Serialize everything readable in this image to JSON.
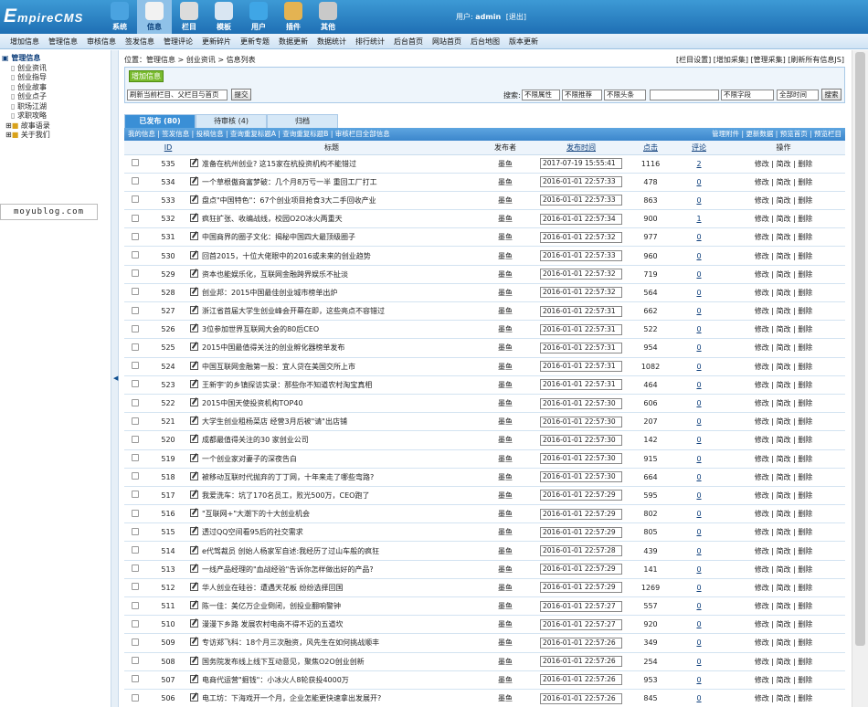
{
  "header": {
    "logo_prefix": "E",
    "logo_rest": "mpireCMS",
    "user_label": "用户:",
    "user_name": "admin",
    "logout": "[退出]",
    "nav": [
      {
        "label": "系统",
        "icon": "globe-icon",
        "color": "#4aa3e0"
      },
      {
        "label": "信息",
        "icon": "document-icon",
        "color": "#f2f2f2"
      },
      {
        "label": "栏目",
        "icon": "folder-icon",
        "color": "#dcdcdc"
      },
      {
        "label": "模板",
        "icon": "template-icon",
        "color": "#d9e6f2"
      },
      {
        "label": "用户",
        "icon": "user-icon",
        "color": "#3fa6e6"
      },
      {
        "label": "插件",
        "icon": "tools-icon",
        "color": "#e4b352"
      },
      {
        "label": "其他",
        "icon": "gear-icon",
        "color": "#c9c9c9"
      }
    ]
  },
  "menu": [
    "增加信息",
    "管理信息",
    "审核信息",
    "签发信息",
    "管理评论",
    "更新碎片",
    "更新专题",
    "数据更新",
    "数据统计",
    "排行统计",
    "后台首页",
    "网站首页",
    "后台地图",
    "版本更新"
  ],
  "tree": {
    "root": "管理信息",
    "items": [
      "创业资讯",
      "创业指导",
      "创业故事",
      "创业点子",
      "职场江湖",
      "求职攻略"
    ],
    "groups": [
      "故事语录",
      "关于我们"
    ]
  },
  "watermark": "moyublog.com",
  "breadcrumb": "位置：管理信息 > 创业资讯 > 信息列表",
  "top_links": "[栏目设置] [增加采集] [管理采集] [刷新所有信息JS]",
  "add_button": "增加信息",
  "refresh_select": "刷新当前栏目、父栏目与首页",
  "refresh_button": "提交",
  "search": {
    "label": "搜索:",
    "f1": "不限属性",
    "f2": "不限推荐",
    "f3": "不限头条",
    "f4": "不限字段",
    "f5": "全部时间",
    "button": "搜索"
  },
  "tabs": [
    "已发布 (80)",
    "待审核 (4)",
    "归档"
  ],
  "subbar_left": "我的信息 | 签发信息 | 投稿信息 | 查询重复标题A | 查询重复标题B | 审核栏目全部信息",
  "subbar_right": "管理附件 | 更新数据 | 预览首页 | 预览栏目",
  "columns": {
    "id": "ID",
    "title": "标题",
    "publisher": "发布者",
    "time": "发布时间",
    "hits": "点击",
    "comments": "评论",
    "ops": "操作"
  },
  "ops_text": "修改 | 简改 | 删除",
  "rows": [
    {
      "id": "535",
      "title": "准备在杭州创业? 这15家在杭投资机构不能错过",
      "pub": "墨鱼",
      "time": "2017-07-19 15:55:41",
      "hits": "1116",
      "cm": "2"
    },
    {
      "id": "534",
      "title": "一个草根傲商富梦破：几个月8万亏一半 重回工厂打工",
      "pub": "墨鱼",
      "time": "2016-01-01 22:57:33",
      "hits": "478",
      "cm": "0"
    },
    {
      "id": "533",
      "title": "盘点\"中国特色\"：67个创业项目抢食3大二手回收产业",
      "pub": "墨鱼",
      "time": "2016-01-01 22:57:33",
      "hits": "863",
      "cm": "0"
    },
    {
      "id": "532",
      "title": "疯狂扩张、收编战线，校园O2O冰火两重天",
      "pub": "墨鱼",
      "time": "2016-01-01 22:57:34",
      "hits": "900",
      "cm": "1"
    },
    {
      "id": "531",
      "title": "中国商界的圈子文化：揭秘中国四大最顶级圈子",
      "pub": "墨鱼",
      "time": "2016-01-01 22:57:32",
      "hits": "977",
      "cm": "0"
    },
    {
      "id": "530",
      "title": "回首2015，十位大佬眼中的2016或未来的创业趋势",
      "pub": "墨鱼",
      "time": "2016-01-01 22:57:33",
      "hits": "960",
      "cm": "0"
    },
    {
      "id": "529",
      "title": "资本也能娱乐化，互联网金融跨界娱乐不扯淡",
      "pub": "墨鱼",
      "time": "2016-01-01 22:57:32",
      "hits": "719",
      "cm": "0"
    },
    {
      "id": "528",
      "title": "创业邦：2015中国最佳创业城市榜单出炉",
      "pub": "墨鱼",
      "time": "2016-01-01 22:57:32",
      "hits": "564",
      "cm": "0"
    },
    {
      "id": "527",
      "title": "浙江省首届大学生创业峰会开幕在即，这些亮点不容错过",
      "pub": "墨鱼",
      "time": "2016-01-01 22:57:31",
      "hits": "662",
      "cm": "0"
    },
    {
      "id": "526",
      "title": "3位参加世界互联网大会的80后CEO",
      "pub": "墨鱼",
      "time": "2016-01-01 22:57:31",
      "hits": "522",
      "cm": "0"
    },
    {
      "id": "525",
      "title": "2015中国最值得关注的创业孵化器榜单发布",
      "pub": "墨鱼",
      "time": "2016-01-01 22:57:31",
      "hits": "954",
      "cm": "0"
    },
    {
      "id": "524",
      "title": "中国互联网金融第一股：宜人贷在美国交所上市",
      "pub": "墨鱼",
      "time": "2016-01-01 22:57:31",
      "hits": "1082",
      "cm": "0"
    },
    {
      "id": "523",
      "title": "王新宇'的乡镇探访实录：那些你不知道农村淘宝真相",
      "pub": "墨鱼",
      "time": "2016-01-01 22:57:31",
      "hits": "464",
      "cm": "0"
    },
    {
      "id": "522",
      "title": "2015中国天使投资机构TOP40",
      "pub": "墨鱼",
      "time": "2016-01-01 22:57:30",
      "hits": "606",
      "cm": "0"
    },
    {
      "id": "521",
      "title": "大学生创业租杨菜店 经营3月后被\"请\"出店铺",
      "pub": "墨鱼",
      "time": "2016-01-01 22:57:30",
      "hits": "207",
      "cm": "0"
    },
    {
      "id": "520",
      "title": "成都最值得关注的30 家创业公司",
      "pub": "墨鱼",
      "time": "2016-01-01 22:57:30",
      "hits": "142",
      "cm": "0"
    },
    {
      "id": "519",
      "title": "一个创业家对妻子的深夜告白",
      "pub": "墨鱼",
      "time": "2016-01-01 22:57:30",
      "hits": "915",
      "cm": "0"
    },
    {
      "id": "518",
      "title": "被移动互联时代抛弃的丁丁网，十年来走了哪些弯路?",
      "pub": "墨鱼",
      "time": "2016-01-01 22:57:30",
      "hits": "664",
      "cm": "0"
    },
    {
      "id": "517",
      "title": "我爱洗车：坑了170名员工，败光500万，CEO跑了",
      "pub": "墨鱼",
      "time": "2016-01-01 22:57:29",
      "hits": "595",
      "cm": "0"
    },
    {
      "id": "516",
      "title": "\"互联网+\"大潮下的十大创业机会",
      "pub": "墨鱼",
      "time": "2016-01-01 22:57:29",
      "hits": "802",
      "cm": "0"
    },
    {
      "id": "515",
      "title": "透过QQ空间看95后的社交需求",
      "pub": "墨鱼",
      "time": "2016-01-01 22:57:29",
      "hits": "805",
      "cm": "0"
    },
    {
      "id": "514",
      "title": "e代驾裁员 创始人杨家军自述:我经历了过山车般的疯狂",
      "pub": "墨鱼",
      "time": "2016-01-01 22:57:28",
      "hits": "439",
      "cm": "0"
    },
    {
      "id": "513",
      "title": "一线产品经理的\"血战经验\"告诉你怎样做出好的产品?",
      "pub": "墨鱼",
      "time": "2016-01-01 22:57:29",
      "hits": "141",
      "cm": "0"
    },
    {
      "id": "512",
      "title": "华人创业在硅谷：遭遇天花板 纷纷选择回国",
      "pub": "墨鱼",
      "time": "2016-01-01 22:57:29",
      "hits": "1269",
      "cm": "0"
    },
    {
      "id": "511",
      "title": "陈一佳：美亿万企业倒闭，创投业翻响警钟",
      "pub": "墨鱼",
      "time": "2016-01-01 22:57:27",
      "hits": "557",
      "cm": "0"
    },
    {
      "id": "510",
      "title": "漫漫下乡路 发展农村电商不得不迈的五道坎",
      "pub": "墨鱼",
      "time": "2016-01-01 22:57:27",
      "hits": "920",
      "cm": "0"
    },
    {
      "id": "509",
      "title": "专访郑飞科：18个月三次融资，风先生在如何挑战顺丰",
      "pub": "墨鱼",
      "time": "2016-01-01 22:57:26",
      "hits": "349",
      "cm": "0"
    },
    {
      "id": "508",
      "title": "国务院发布线上线下互动意见，聚焦O2O创业创新",
      "pub": "墨鱼",
      "time": "2016-01-01 22:57:26",
      "hits": "254",
      "cm": "0"
    },
    {
      "id": "507",
      "title": "电商代运营\"掘钱\"：小冰火人8轮获投4000万",
      "pub": "墨鱼",
      "time": "2016-01-01 22:57:26",
      "hits": "953",
      "cm": "0"
    },
    {
      "id": "506",
      "title": "电工坊：下海戏开一个月，企业怎能更快速拿出发展开?",
      "pub": "墨鱼",
      "time": "2016-01-01 22:57:26",
      "hits": "845",
      "cm": "0"
    }
  ]
}
